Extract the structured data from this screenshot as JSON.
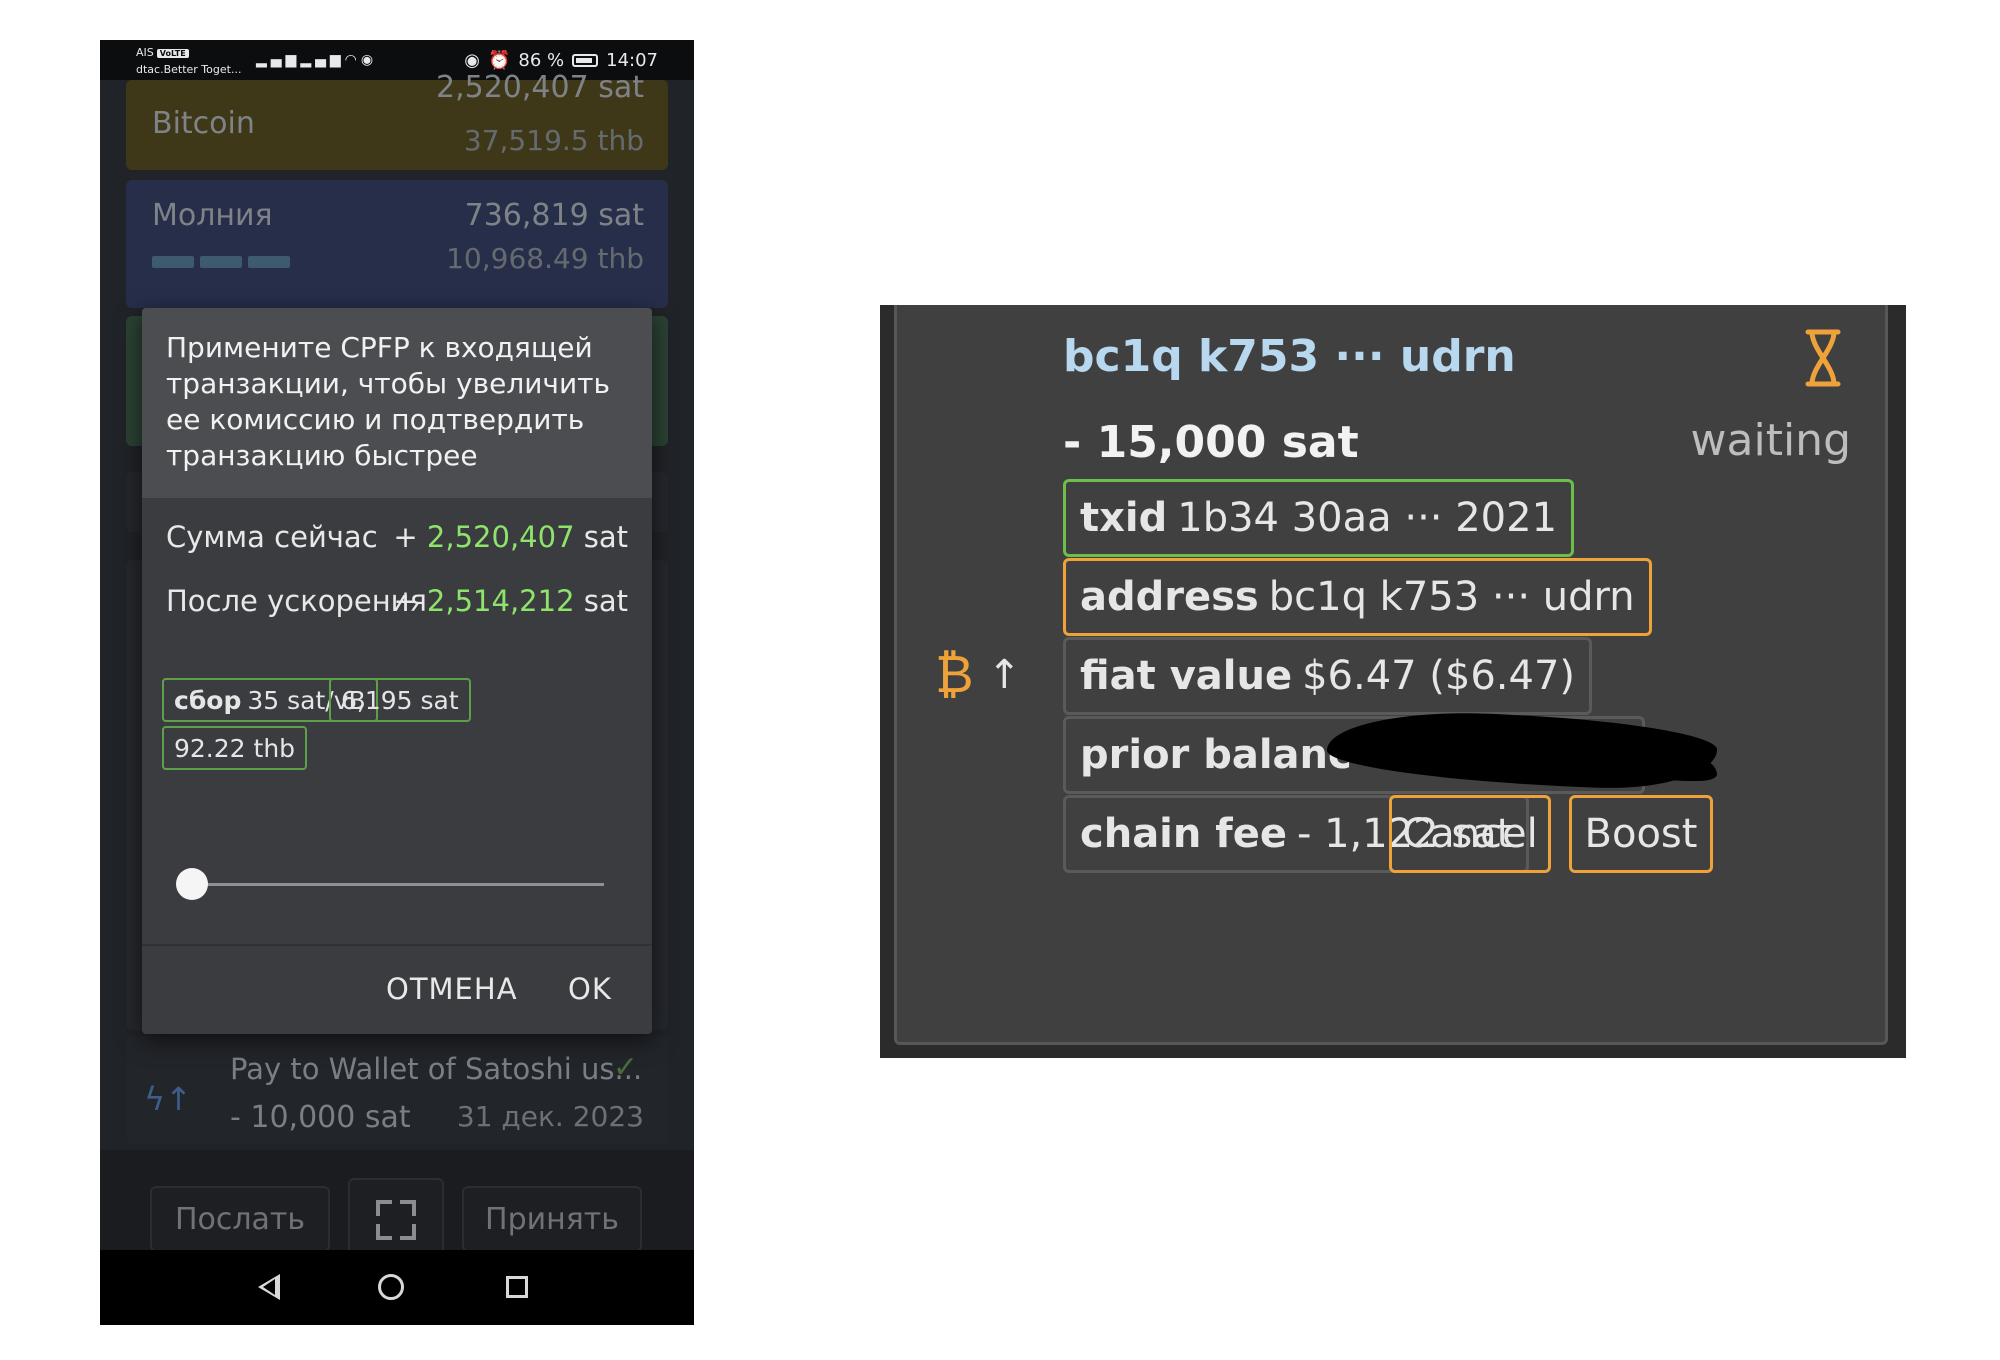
{
  "phone": {
    "status_bar": {
      "carrier_line1": "AIS",
      "volte_badge": "VoLTE",
      "carrier_line2": "dtac.Better Toget...",
      "battery_percent": "86 %",
      "time": "14:07"
    },
    "balances": [
      {
        "name": "Bitcoin",
        "amount": "2,520,407 sat",
        "fiat": "37,519.5 thb",
        "color": "#3f3818"
      },
      {
        "name": "Молния",
        "amount": "736,819 sat",
        "fiat": "10,968.49 thb",
        "color": "#272e49"
      }
    ],
    "dialog": {
      "message": "Примените CPFP к входящей транзакции, чтобы увеличить ее комиссию и подтвердить транзакцию быстрее",
      "current_label": "Сумма сейчас",
      "current_sign": "+",
      "current_value": "2,520,407",
      "current_unit": "sat",
      "after_label": "После ускорения",
      "after_sign": "+",
      "after_value": "2,514,212",
      "after_unit": "sat",
      "fee_label": "сбор",
      "fee_rate": "35 sat/vB",
      "fee_sat": "6,195 sat",
      "fee_fiat": "92.22 thb",
      "slider_value": 0.0,
      "cancel_label": "ОТМЕНА",
      "ok_label": "OK",
      "accent_color": "#8ee46a"
    },
    "transaction": {
      "title": "Pay to Wallet of Satoshi us...",
      "amount": "- 10,000 sat",
      "date": "31 дек. 2023",
      "icon": "lightning-icon",
      "status_icon": "check-icon"
    },
    "bottom_bar": {
      "send_label": "Послать",
      "scan_icon": "qr-scan-icon",
      "receive_label": "Принять"
    },
    "nav": {
      "back_icon": "back-triangle-icon",
      "home_icon": "home-circle-icon",
      "recent_icon": "recent-square-icon"
    }
  },
  "panel": {
    "address_title": "bc1q k753 ··· udrn",
    "amount": "- 15,000 sat",
    "status": "waiting",
    "status_icon": "hourglass-icon",
    "type_icon": "bitcoin-icon",
    "direction_icon": "arrow-up-icon",
    "tags": {
      "txid_label": "txid",
      "txid_value": "1b34 30aa ··· 2021",
      "address_label": "address",
      "address_value": "bc1q k753 ··· udrn",
      "fiat_label": "fiat value",
      "fiat_value": "$6.47 ($6.47)",
      "prior_label": "prior balanc",
      "chain_fee_label": "chain fee",
      "chain_fee_value": "- 1,122 sat"
    },
    "buttons": {
      "cancel": "Cancel",
      "boost": "Boost"
    },
    "colors": {
      "orange": "#f0a23a",
      "green": "#6bbf4a",
      "address_blue": "#b8d8f0"
    }
  }
}
